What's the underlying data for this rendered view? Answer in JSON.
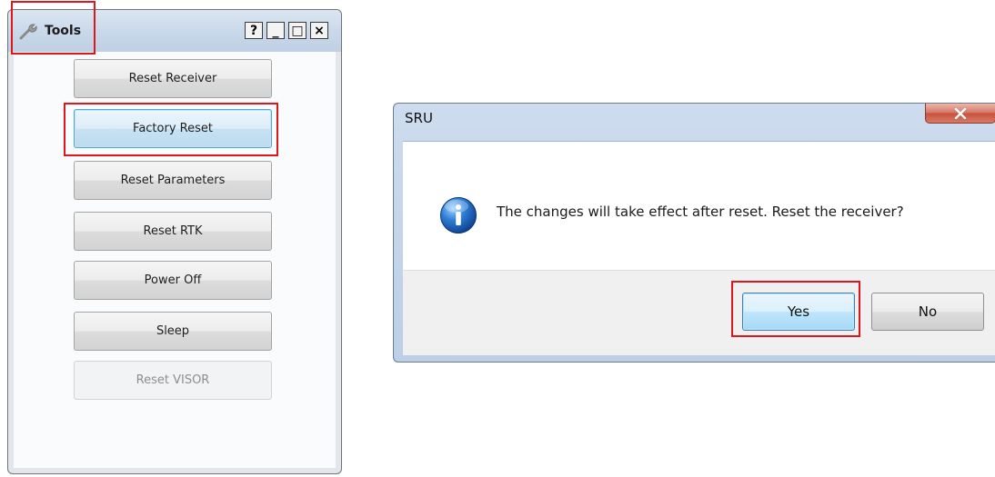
{
  "tools_window": {
    "title": "Tools",
    "title_buttons": {
      "help": "?",
      "minimize": "_",
      "maximize": "□",
      "close": "×"
    },
    "buttons": [
      {
        "label": "Reset Receiver",
        "state": "normal"
      },
      {
        "label": "Factory Reset",
        "state": "focused"
      },
      {
        "label": "Reset Parameters",
        "state": "normal"
      },
      {
        "label": "Reset RTK",
        "state": "normal"
      },
      {
        "label": "Power Off",
        "state": "normal"
      },
      {
        "label": "Sleep",
        "state": "normal"
      },
      {
        "label": "Reset VISOR",
        "state": "disabled"
      }
    ]
  },
  "sru_dialog": {
    "title": "SRU",
    "message": "The changes will take effect after reset. Reset the receiver?",
    "icon": "info-icon",
    "buttons": {
      "yes": "Yes",
      "no": "No"
    }
  },
  "colors": {
    "highlight": "#e0161d",
    "focus_blue": "#4fa6d8",
    "close_red": "#c7503a"
  }
}
